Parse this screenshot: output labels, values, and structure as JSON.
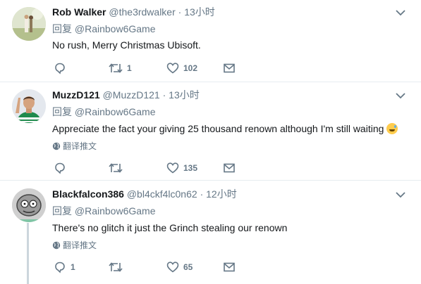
{
  "tweets": [
    {
      "name": "Rob Walker",
      "handle": "@the3rdwalker",
      "dot": "·",
      "time": "13小时",
      "reply_prefix": "回复",
      "reply_to": "@Rainbow6Game",
      "text": "No rush, Merry Christmas Ubisoft.",
      "reply_count": "",
      "retweet_count": "1",
      "like_count": "102"
    },
    {
      "name": "MuzzD121",
      "handle": "@MuzzD121",
      "dot": "·",
      "time": "13小时",
      "reply_prefix": "回复",
      "reply_to": "@Rainbow6Game",
      "text": "Appreciate the fact your giving 25 thousand renown although I'm still waiting",
      "translate": "翻译推文",
      "reply_count": "",
      "retweet_count": "",
      "like_count": "135"
    },
    {
      "name": "Blackfalcon386",
      "handle": "@bl4ckf4lc0n62",
      "dot": "·",
      "time": "12小时",
      "reply_prefix": "回复",
      "reply_to": "@Rainbow6Game",
      "text": "There's no glitch it just the Grinch stealing our renown",
      "translate": "翻译推文",
      "reply_count": "1",
      "retweet_count": "",
      "like_count": "65"
    }
  ],
  "icons": {
    "reply": "reply-icon",
    "retweet": "retweet-icon",
    "like": "heart-icon",
    "dm": "envelope-icon",
    "menu": "chevron-down-icon",
    "globe": "globe-icon"
  },
  "colors": {
    "text_primary": "#14171a",
    "text_secondary": "#657786",
    "divider": "#e6ecf0"
  }
}
